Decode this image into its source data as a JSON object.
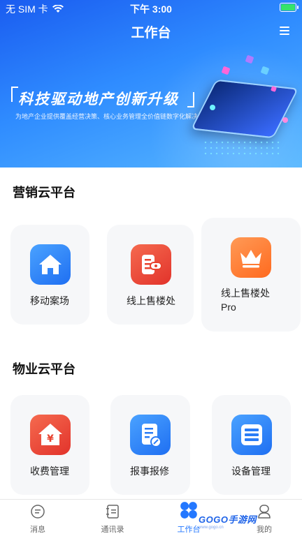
{
  "status_bar": {
    "carrier": "无 SIM 卡",
    "time": "下午 3:00"
  },
  "header": {
    "title": "工作台"
  },
  "banner": {
    "slogan": "科技驱动地产创新升级",
    "subtitle": "为地产企业提供覆盖经营决策、核心业务管理全价值链数字化解决方案"
  },
  "sections": [
    {
      "title": "营销云平台",
      "items": [
        {
          "label": "移动案场",
          "icon": "house-icon",
          "color": "#2a7cf6"
        },
        {
          "label": "线上售楼处",
          "icon": "sales-office-icon",
          "color": "#e8432f"
        },
        {
          "label": "线上售楼处Pro",
          "icon": "crown-icon",
          "color": "#ff7a2b"
        }
      ]
    },
    {
      "title": "物业云平台",
      "items": [
        {
          "label": "收费管理",
          "icon": "yuan-house-icon",
          "color": "#e8432f"
        },
        {
          "label": "报事报修",
          "icon": "repair-doc-icon",
          "color": "#2a7cf6"
        },
        {
          "label": "设备管理",
          "icon": "device-list-icon",
          "color": "#2a7cf6"
        }
      ]
    }
  ],
  "tabbar": {
    "tabs": [
      {
        "label": "消息",
        "icon": "message-icon"
      },
      {
        "label": "通讯录",
        "icon": "contacts-icon"
      },
      {
        "label": "工作台",
        "icon": "workbench-icon",
        "active": true
      },
      {
        "label": "我的",
        "icon": "profile-icon"
      }
    ]
  },
  "watermark": {
    "text": "GOGO手游网",
    "sub": "www.gogo.cn"
  }
}
